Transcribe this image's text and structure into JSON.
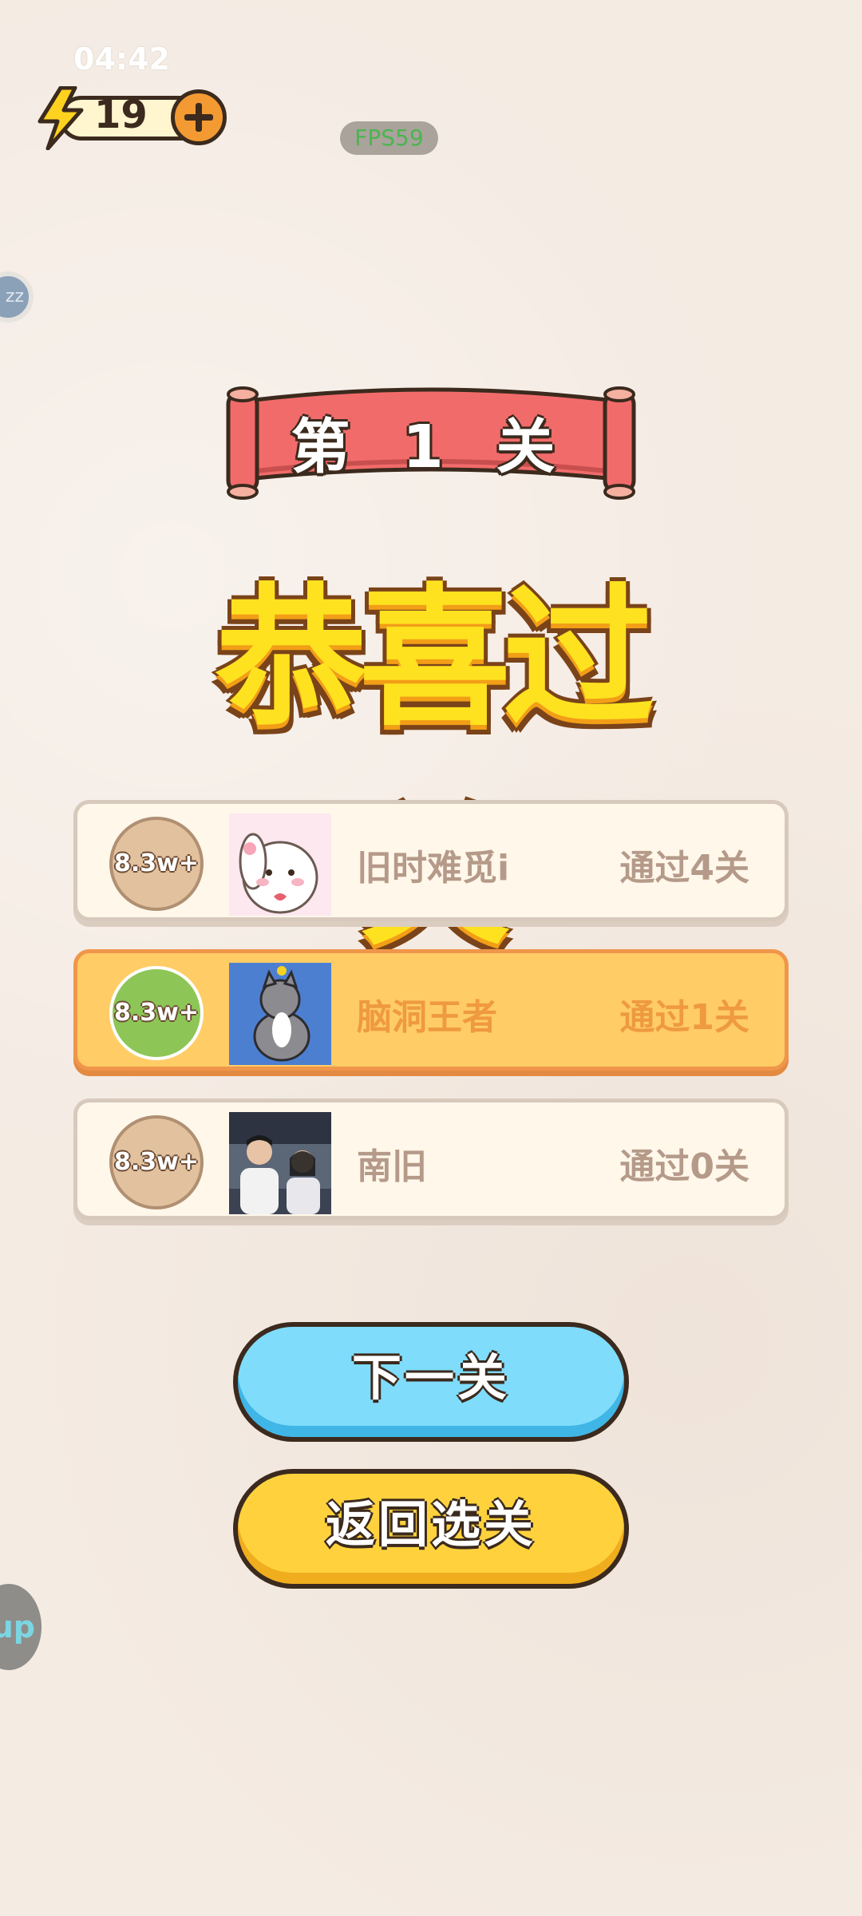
{
  "status": {
    "time": "04:42"
  },
  "energy": {
    "count": "19"
  },
  "fps": {
    "label": "FPS59"
  },
  "side_badge": {
    "label": "zz"
  },
  "side_app": {
    "label": "up"
  },
  "banner": {
    "level": "第 1 关"
  },
  "congrats": {
    "title": "恭喜过关"
  },
  "ranking": [
    {
      "score": "8.3w+",
      "name": "旧时难觅i",
      "level": "通过4关"
    },
    {
      "score": "8.3w+",
      "name": "脑洞王者",
      "level": "通过1关"
    },
    {
      "score": "8.3w+",
      "name": "南旧",
      "level": "通过0关"
    }
  ],
  "buttons": {
    "next": "下一关",
    "back": "返回选关"
  },
  "colors": {
    "background": "#f4ebe3",
    "banner_red": "#f26b6b",
    "congrats_yellow": "#ffe21f",
    "next_blue": "#7fdcfb",
    "back_yellow": "#ffd23d",
    "highlight_row": "#ffcc66"
  }
}
